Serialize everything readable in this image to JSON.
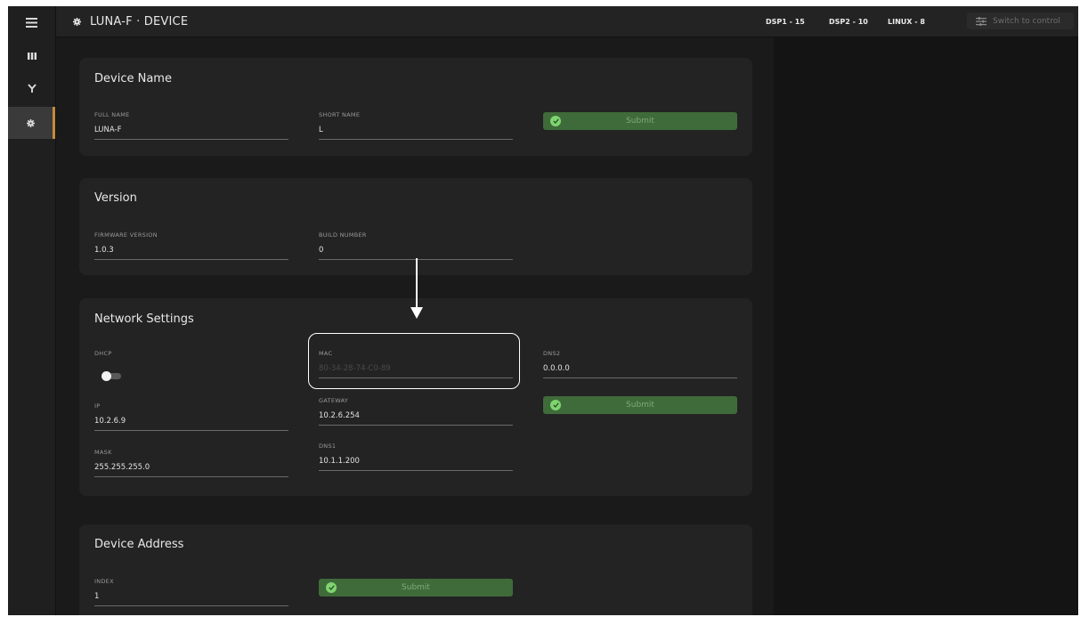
{
  "header": {
    "title": "LUNA-F · DEVICE",
    "status": [
      {
        "label": "DSP1 - 15"
      },
      {
        "label": "DSP2 - 10"
      },
      {
        "label": "LINUX - 8"
      }
    ],
    "switch_label": "Switch to control"
  },
  "sidebar": {
    "items": [
      {
        "icon": "menu-icon"
      },
      {
        "icon": "bars-icon"
      },
      {
        "icon": "fork-icon"
      },
      {
        "icon": "gear-icon",
        "active": true
      }
    ]
  },
  "device_name": {
    "title": "Device Name",
    "full_name": {
      "label": "FULL NAME",
      "value": "LUNA-F"
    },
    "short_name": {
      "label": "SHORT NAME",
      "value": "L"
    },
    "submit_label": "Submit"
  },
  "version": {
    "title": "Version",
    "firmware": {
      "label": "FIRMWARE VERSION",
      "value": "1.0.3"
    },
    "build": {
      "label": "BUILD NUMBER",
      "value": "0"
    }
  },
  "network": {
    "title": "Network Settings",
    "dhcp": {
      "label": "DHCP",
      "enabled": true
    },
    "ip": {
      "label": "IP",
      "value": "10.2.6.9"
    },
    "mask": {
      "label": "MASK",
      "value": "255.255.255.0"
    },
    "mac": {
      "label": "MAC",
      "value": "80-34-28-74-C0-89"
    },
    "gateway": {
      "label": "GATEWAY",
      "value": "10.2.6.254"
    },
    "dns1": {
      "label": "DNS1",
      "value": "10.1.1.200"
    },
    "dns2": {
      "label": "DNS2",
      "value": "0.0.0.0"
    },
    "submit_label": "Submit"
  },
  "device_address": {
    "title": "Device Address",
    "index": {
      "label": "INDEX",
      "value": "1"
    },
    "submit_label": "Submit"
  },
  "colors": {
    "accent": "#c48a3a",
    "submit_bg": "#3f6b3a",
    "check": "#7ed56f",
    "background": "#1a1a1a",
    "card": "#232323"
  }
}
